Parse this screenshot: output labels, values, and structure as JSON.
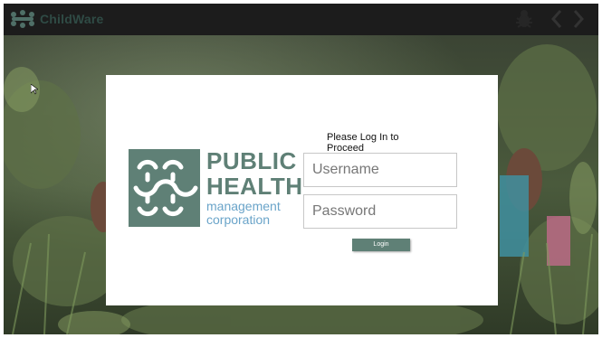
{
  "app": {
    "title": "ChildWare",
    "icons": {
      "logo": "childware-logo-icon",
      "bug": "bug-icon",
      "back": "chevron-left-icon",
      "forward": "chevron-right-icon"
    }
  },
  "login": {
    "heading": "Please Log In to Proceed",
    "username_placeholder": "Username",
    "password_placeholder": "Password",
    "button_label": "Login"
  },
  "org_logo": {
    "line1": "PUBLIC",
    "line2": "HEALTH",
    "line3": "management",
    "line4": "corporation"
  },
  "colors": {
    "brand_green": "#5f8076",
    "brand_blue": "#6aa4c9",
    "topbar": "#1c1c1c"
  }
}
